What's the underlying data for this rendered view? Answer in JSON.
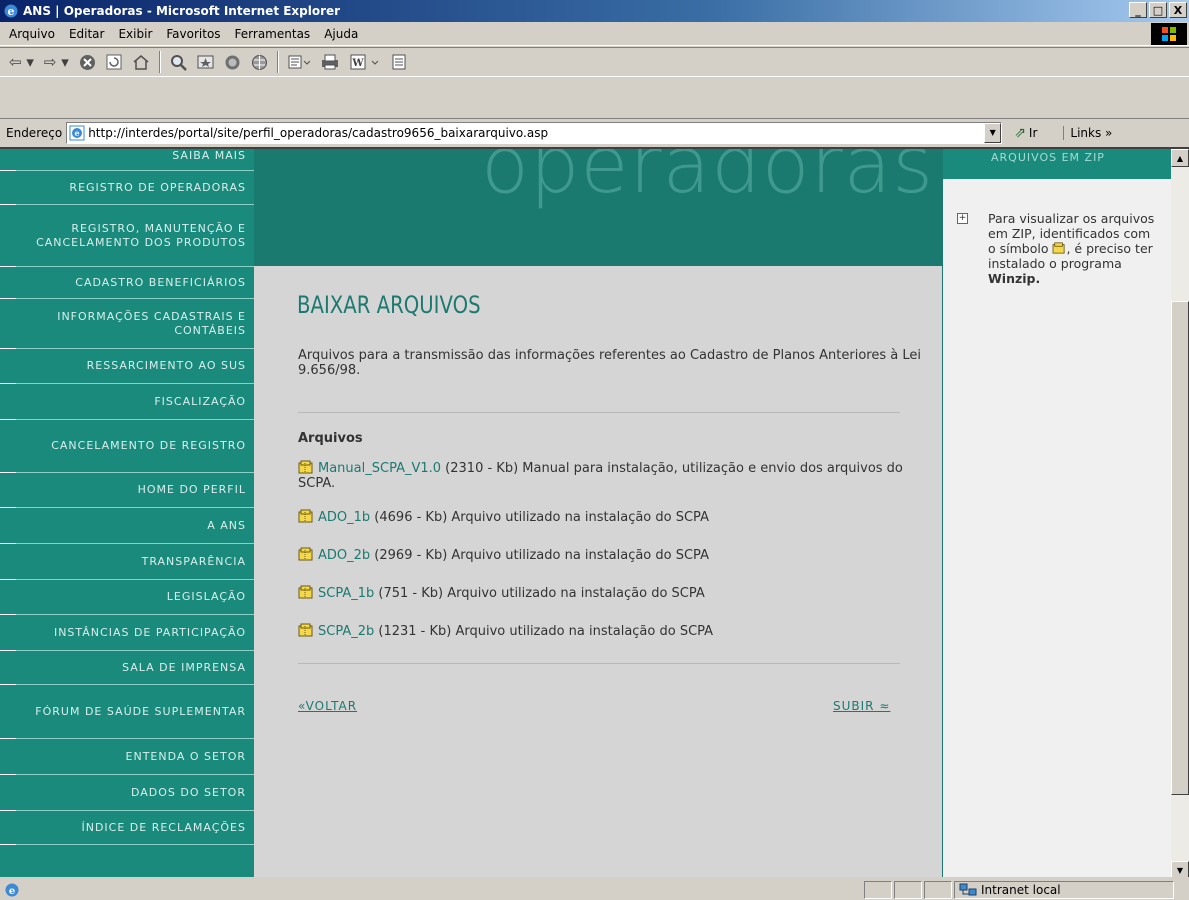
{
  "window": {
    "title": "ANS | Operadoras - Microsoft Internet Explorer",
    "controls": [
      "_",
      "□",
      "X"
    ]
  },
  "menubar": {
    "items": [
      "Arquivo",
      "Editar",
      "Exibir",
      "Favoritos",
      "Ferramentas",
      "Ajuda"
    ]
  },
  "toolbar": {
    "icons": [
      "back-icon",
      "forward-icon",
      "stop-icon",
      "refresh-icon",
      "home-icon",
      "search-icon",
      "favorites-icon",
      "history-icon",
      "mail-icon",
      "print-icon",
      "word-icon",
      "discuss-icon"
    ]
  },
  "addressbar": {
    "label": "Endereço",
    "url": "http://interdes/portal/site/perfil_operadoras/cadastro9656_baixararquivo.asp",
    "go_label": "Ir",
    "links_label": "Links »"
  },
  "leftnav": {
    "items": [
      {
        "label": "SAIBA MAIS"
      },
      {
        "label": "REGISTRO DE OPERADORAS"
      },
      {
        "label": "REGISTRO, MANUTENÇÃO E CANCELAMENTO DOS PRODUTOS"
      },
      {
        "label": "CADASTRO BENEFICIÁRIOS"
      },
      {
        "label": "INFORMAÇÕES CADASTRAIS E CONTÁBEIS"
      },
      {
        "label": "RESSARCIMENTO AO SUS"
      },
      {
        "label": "FISCALIZAÇÃO"
      },
      {
        "label": "CANCELAMENTO DE REGISTRO"
      },
      {
        "label": "HOME DO PERFIL"
      },
      {
        "label": "A ANS"
      },
      {
        "label": "TRANSPARÊNCIA"
      },
      {
        "label": "LEGISLAÇÃO"
      },
      {
        "label": "INSTÂNCIAS DE PARTICIPAÇÃO"
      },
      {
        "label": "SALA DE IMPRENSA"
      },
      {
        "label": "FÓRUM DE SAÚDE SUPLEMENTAR"
      },
      {
        "label": "ENTENDA O SETOR"
      },
      {
        "label": "DADOS DO SETOR"
      },
      {
        "label": "ÍNDICE DE RECLAMAÇÕES"
      }
    ]
  },
  "banner": {
    "word": "operadoras"
  },
  "main": {
    "title": "BAIXAR ARQUIVOS",
    "intro": "Arquivos para a transmissão das informações referentes ao Cadastro de Planos Anteriores à Lei 9.656/98.",
    "section_label": "Arquivos",
    "files": [
      {
        "name": "Manual_SCPA_V1.0",
        "desc": " (2310 - Kb) Manual para instalação, utilização e envio dos arquivos do SCPA."
      },
      {
        "name": "ADO_1b",
        "desc": " (4696 - Kb) Arquivo utilizado na instalação do SCPA"
      },
      {
        "name": "ADO_2b",
        "desc": " (2969 - Kb) Arquivo utilizado na instalação do SCPA"
      },
      {
        "name": "SCPA_1b",
        "desc": " (751 - Kb) Arquivo utilizado na instalação do SCPA"
      },
      {
        "name": "SCPA_2b",
        "desc": " (1231 - Kb) Arquivo utilizado na instalação do SCPA"
      }
    ],
    "back_label": "«VOLTAR",
    "top_label": "SUBIR ≈"
  },
  "rightcol": {
    "heading": "ARQUIVOS EM ZIP",
    "note_part1": "Para visualizar os arquivos em ZIP, identificados com o símbolo ",
    "note_part2": ", é preciso ter instalado o programa ",
    "note_bold": "Winzip."
  },
  "statusbar": {
    "zone": "Intranet local"
  },
  "colors": {
    "teal": "#1a8a7d",
    "dark_teal": "#1a7a70",
    "content_grey": "#d6d5d6",
    "title_bar": "#0a246a"
  }
}
